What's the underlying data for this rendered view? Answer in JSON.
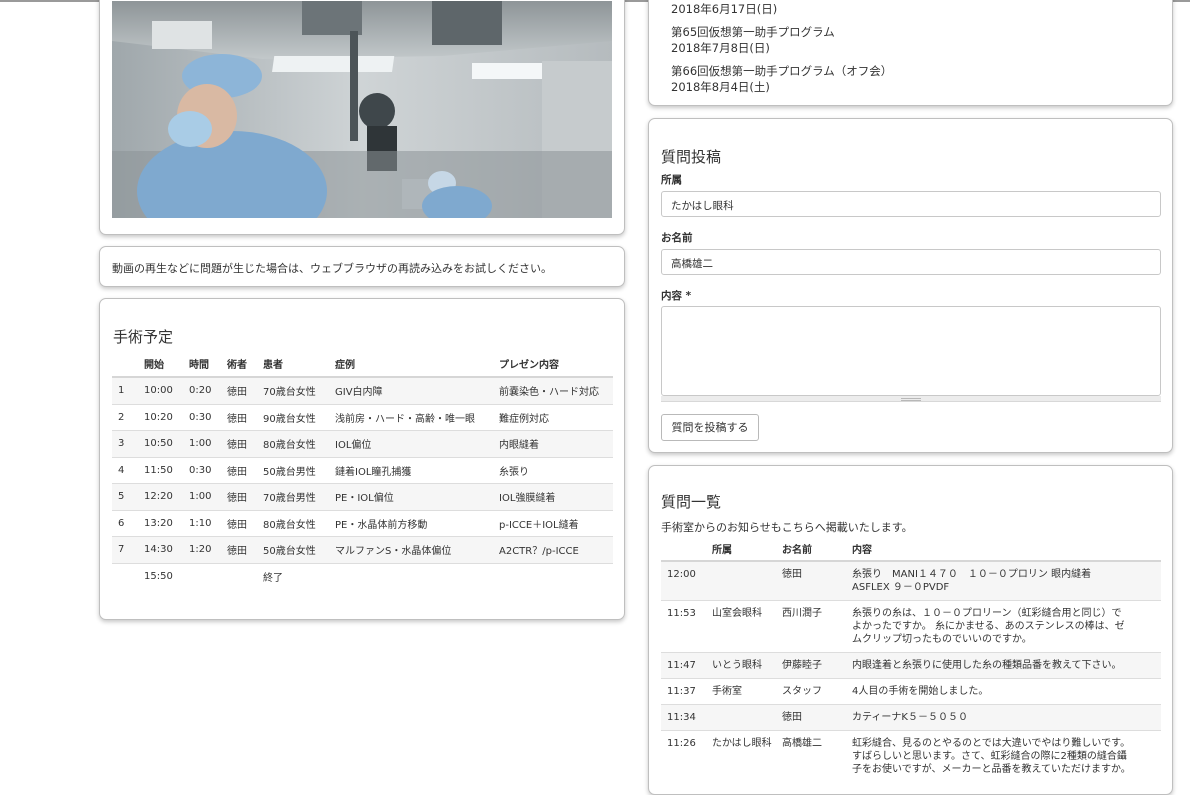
{
  "notice": "動画の再生などに問題が生じた場合は、ウェブブラウザの再読み込みをお試しください。",
  "events": [
    {
      "date": "2018年6月17日(日)"
    },
    {
      "title": "第65回仮想第一助手プログラム",
      "date": "2018年7月8日(日)"
    },
    {
      "title": "第66回仮想第一助手プログラム（オフ会）",
      "date": "2018年8月4日(土)"
    }
  ],
  "schedule": {
    "title": "手術予定",
    "headers": [
      "",
      "開始",
      "時間",
      "術者",
      "患者",
      "症例",
      "プレゼン内容"
    ],
    "rows": [
      [
        "1",
        "10:00",
        "0:20",
        "徳田",
        "70歳台女性",
        "GIV白内障",
        "前嚢染色・ハード対応"
      ],
      [
        "2",
        "10:20",
        "0:30",
        "徳田",
        "90歳台女性",
        "浅前房・ハード・高齢・唯一眼",
        "難症例対応"
      ],
      [
        "3",
        "10:50",
        "1:00",
        "徳田",
        "80歳台女性",
        "IOL偏位",
        "内眼縫着"
      ],
      [
        "4",
        "11:50",
        "0:30",
        "徳田",
        "50歳台男性",
        "鏈着IOL瞳孔捕獲",
        "糸張り"
      ],
      [
        "5",
        "12:20",
        "1:00",
        "徳田",
        "70歳台男性",
        "PE・IOL偏位",
        "IOL強膜縫着"
      ],
      [
        "6",
        "13:20",
        "1:10",
        "徳田",
        "80歳台女性",
        "PE・水晶体前方移動",
        "p-ICCE＋IOL縫着"
      ],
      [
        "7",
        "14:30",
        "1:20",
        "徳田",
        "50歳台女性",
        "マルファンS・水晶体偏位",
        "A2CTR？/p-ICCE"
      ],
      [
        "",
        "15:50",
        "",
        "",
        "終了",
        "",
        ""
      ]
    ]
  },
  "post_form": {
    "title": "質問投稿",
    "affiliation_label": "所属",
    "affiliation_value": "たかはし眼科",
    "name_label": "お名前",
    "name_value": "高橋雄二",
    "content_label": "内容 *",
    "content_value": "",
    "submit_label": "質問を投稿する"
  },
  "question_list": {
    "title": "質問一覧",
    "note": "手術室からのお知らせもこちらへ掲載いたします。",
    "headers": [
      "",
      "所属",
      "お名前",
      "内容"
    ],
    "rows": [
      {
        "time": "12:00",
        "affiliation": "",
        "name": "徳田",
        "content": "糸張り　MANI１４７０　１０－０プロリン 眼内縫着　ASFLEX ９－０PVDF"
      },
      {
        "time": "11:53",
        "affiliation": "山室会眼科",
        "name": "西川潤子",
        "content": "糸張りの糸は、１０－０プロリーン（虹彩縫合用と同じ）でよかったですか。 糸にかませる、あのステンレスの棒は、ゼムクリップ切ったものでいいのですか。"
      },
      {
        "time": "11:47",
        "affiliation": "いとう眼科",
        "name": "伊藤睦子",
        "content": "内眼逢着と糸張りに使用した糸の種類品番を教えて下さい。"
      },
      {
        "time": "11:37",
        "affiliation": "手術室",
        "name": "スタッフ",
        "content": "4人目の手術を開始しました。"
      },
      {
        "time": "11:34",
        "affiliation": "",
        "name": "徳田",
        "content": "カティーナK５－５０５０"
      },
      {
        "time": "11:26",
        "affiliation": "たかはし眼科",
        "name": "高橋雄二",
        "content": "虹彩縫合、見るのとやるのとでは大違いでやはり難しいです。すばらしいと思います。さて、虹彩縫合の際に2種類の縫合鑷子をお使いですが、メーカーと品番を教えていただけますか。"
      }
    ]
  },
  "colors": {
    "card_border": "#bfbfbf",
    "row_stripe": "#f6f6f6",
    "text": "#333333",
    "scrubs": "#7fa9cf"
  }
}
